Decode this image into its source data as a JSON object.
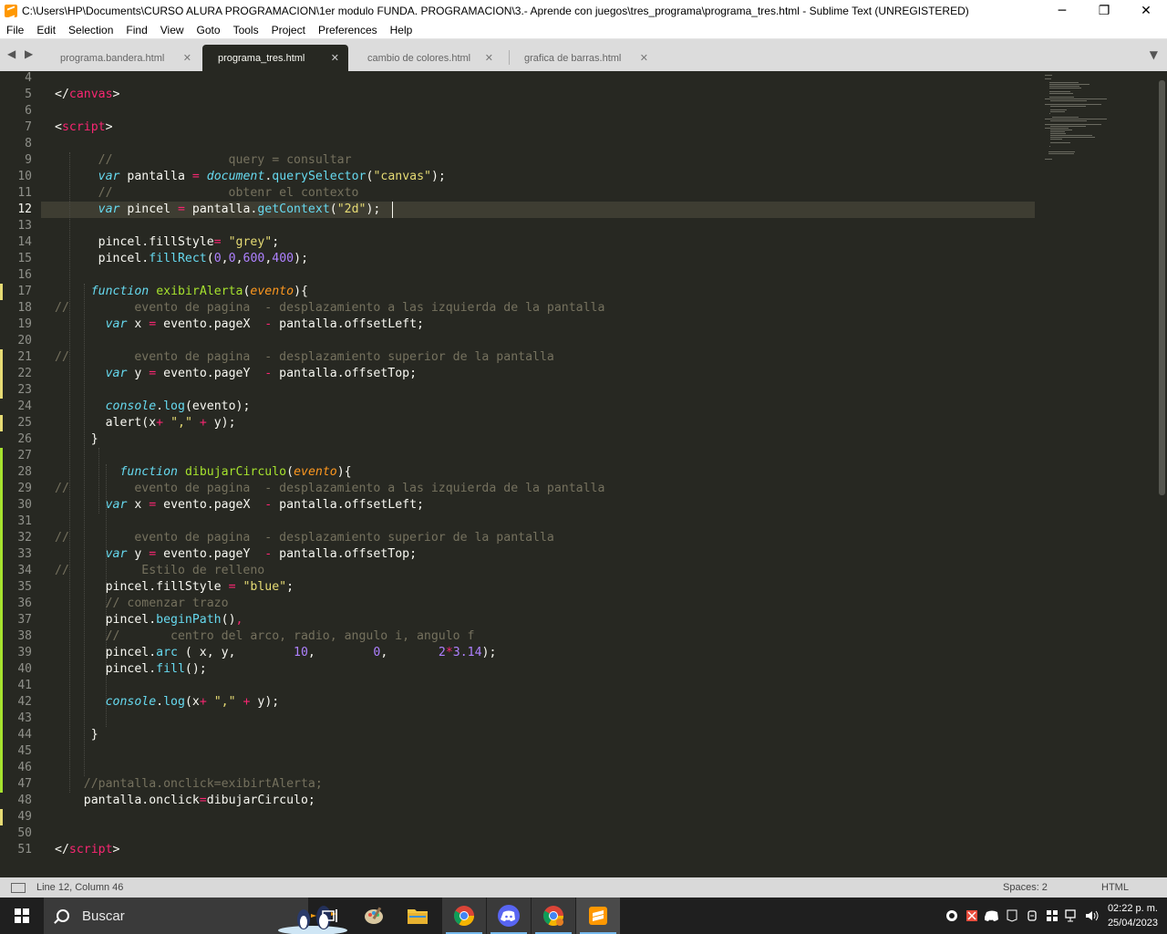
{
  "window": {
    "title": "C:\\Users\\HP\\Documents\\CURSO ALURA PROGRAMACION\\1er modulo FUNDA. PROGRAMACION\\3.- Aprende con juegos\\tres_programa\\programa_tres.html - Sublime Text (UNREGISTERED)",
    "minimize": "─",
    "maximize": "❐",
    "close": "✕"
  },
  "menu": [
    "File",
    "Edit",
    "Selection",
    "Find",
    "View",
    "Goto",
    "Tools",
    "Project",
    "Preferences",
    "Help"
  ],
  "tabs": [
    {
      "label": "programa.bandera.html",
      "active": false
    },
    {
      "label": "programa_tres.html",
      "active": true
    },
    {
      "label": "cambio de colores.html",
      "active": false
    },
    {
      "label": "grafica de barras.html",
      "active": false
    }
  ],
  "tab_nav": "◀ ▶",
  "tab_close": "✕",
  "tab_dropdown": "▼",
  "editor": {
    "current_line": 12,
    "lines": [
      {
        "n": "4",
        "html": ""
      },
      {
        "n": "5",
        "html": "&lt;/<span class=\"tag\">canvas</span>&gt;"
      },
      {
        "n": "6",
        "html": ""
      },
      {
        "n": "7",
        "html": "&lt;<span class=\"tag\">script</span>&gt;"
      },
      {
        "n": "8",
        "html": ""
      },
      {
        "n": "9",
        "html": "      <span class=\"cm\">//                query = consultar</span>"
      },
      {
        "n": "10",
        "html": "      <span class=\"kw\">var</span> pantalla <span class=\"op\">=</span> <span class=\"obj\">document</span>.<span class=\"prop\">querySelector</span>(<span class=\"str\">\"canvas\"</span>);"
      },
      {
        "n": "11",
        "html": "      <span class=\"cm\">//                obtenr el contexto</span>"
      },
      {
        "n": "12",
        "html": "      <span class=\"kw\">var</span> pincel <span class=\"op\">=</span> pantalla.<span class=\"prop\">getContext</span>(<span class=\"str\">\"2d\"</span>);"
      },
      {
        "n": "13",
        "html": ""
      },
      {
        "n": "14",
        "html": "      pincel.fillStyle<span class=\"op\">=</span> <span class=\"str\">\"grey\"</span>;"
      },
      {
        "n": "15",
        "html": "      pincel.<span class=\"prop\">fillRect</span>(<span class=\"num\">0</span>,<span class=\"num\">0</span>,<span class=\"num\">600</span>,<span class=\"num\">400</span>);"
      },
      {
        "n": "16",
        "html": ""
      },
      {
        "n": "17",
        "html": "     <span class=\"kw\">function</span> <span class=\"fn\">exibirAlerta</span>(<span class=\"param\">evento</span>){"
      },
      {
        "n": "18",
        "html": "<span class=\"cm\">//         evento de pagina  - desplazamiento a las izquierda de la pantalla</span>"
      },
      {
        "n": "19",
        "html": "       <span class=\"kw\">var</span> x <span class=\"op\">=</span> evento.pageX  <span class=\"op\">-</span> pantalla.offsetLeft;"
      },
      {
        "n": "20",
        "html": ""
      },
      {
        "n": "21",
        "html": "<span class=\"cm\">//         evento de pagina  - desplazamiento superior de la pantalla</span>"
      },
      {
        "n": "22",
        "html": "       <span class=\"kw\">var</span> y <span class=\"op\">=</span> evento.pageY  <span class=\"op\">-</span> pantalla.offsetTop;"
      },
      {
        "n": "23",
        "html": ""
      },
      {
        "n": "24",
        "html": "       <span class=\"obj\">console</span>.<span class=\"prop\">log</span>(evento);"
      },
      {
        "n": "25",
        "html": "       alert(x<span class=\"op\">+</span> <span class=\"str\">\",\"</span> <span class=\"op\">+</span> y);"
      },
      {
        "n": "26",
        "html": "     }"
      },
      {
        "n": "27",
        "html": ""
      },
      {
        "n": "28",
        "html": "         <span class=\"kw\">function</span> <span class=\"fn\">dibujarCirculo</span>(<span class=\"param\">evento</span>){"
      },
      {
        "n": "29",
        "html": "<span class=\"cm\">//         evento de pagina  - desplazamiento a las izquierda de la pantalla</span>"
      },
      {
        "n": "30",
        "html": "       <span class=\"kw\">var</span> x <span class=\"op\">=</span> evento.pageX  <span class=\"op\">-</span> pantalla.offsetLeft;"
      },
      {
        "n": "31",
        "html": ""
      },
      {
        "n": "32",
        "html": "<span class=\"cm\">//         evento de pagina  - desplazamiento superior de la pantalla</span>"
      },
      {
        "n": "33",
        "html": "       <span class=\"kw\">var</span> y <span class=\"op\">=</span> evento.pageY  <span class=\"op\">-</span> pantalla.offsetTop;"
      },
      {
        "n": "34",
        "html": "<span class=\"cm\">//          Estilo de relleno</span>"
      },
      {
        "n": "35",
        "html": "       pincel.fillStyle <span class=\"op\">=</span> <span class=\"str\">\"blue\"</span>;"
      },
      {
        "n": "36",
        "html": "       <span class=\"cm\">// comenzar trazo</span>"
      },
      {
        "n": "37",
        "html": "       pincel.<span class=\"prop\">beginPath</span>()<span class=\"op\">,</span>"
      },
      {
        "n": "38",
        "html": "       <span class=\"cm\">//       centro del arco, radio, angulo i, angulo f</span>"
      },
      {
        "n": "39",
        "html": "       pincel.<span class=\"prop\">arc</span> ( x, y,        <span class=\"num\">10</span>,        <span class=\"num\">0</span>,       <span class=\"num\">2</span><span class=\"op\">*</span><span class=\"num\">3.14</span>);"
      },
      {
        "n": "40",
        "html": "       pincel.<span class=\"prop\">fill</span>();"
      },
      {
        "n": "41",
        "html": ""
      },
      {
        "n": "42",
        "html": "       <span class=\"obj\">console</span>.<span class=\"prop\">log</span>(x<span class=\"op\">+</span> <span class=\"str\">\",\"</span> <span class=\"op\">+</span> y);"
      },
      {
        "n": "43",
        "html": ""
      },
      {
        "n": "44",
        "html": "     }"
      },
      {
        "n": "45",
        "html": ""
      },
      {
        "n": "46",
        "html": ""
      },
      {
        "n": "47",
        "html": "    <span class=\"cm\">//pantalla.onclick=exibirtAlerta;</span>"
      },
      {
        "n": "48",
        "html": "    pantalla.onclick<span class=\"op\">=</span>dibujarCirculo;"
      },
      {
        "n": "49",
        "html": ""
      },
      {
        "n": "50",
        "html": ""
      },
      {
        "n": "51",
        "html": "&lt;/<span class=\"tag\">script</span>&gt;"
      }
    ]
  },
  "status": {
    "position": "Line 12, Column 46",
    "spaces": "Spaces: 2",
    "syntax": "HTML"
  },
  "taskbar": {
    "search_placeholder": "Buscar",
    "clock_time": "02:22 p. m.",
    "clock_date": "25/04/2023"
  }
}
